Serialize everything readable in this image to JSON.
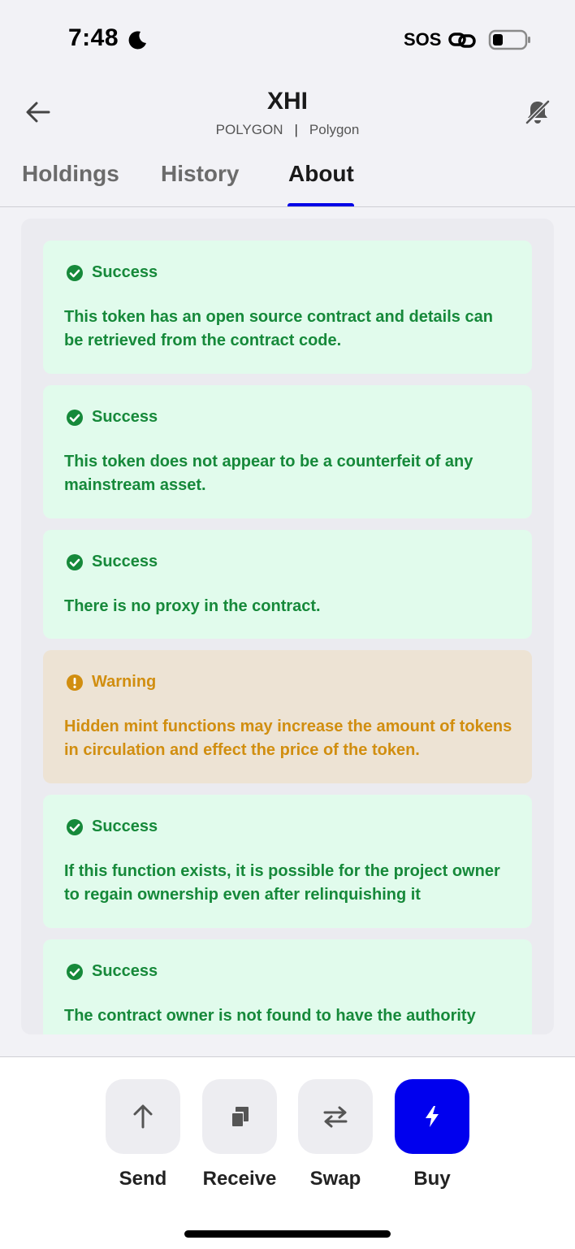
{
  "status_bar": {
    "time": "7:48",
    "sos": "SOS",
    "icons": [
      "moon-icon",
      "link-icon",
      "battery-icon"
    ]
  },
  "header": {
    "title": "XHI",
    "network_code": "POLYGON",
    "separator": "|",
    "network_name": "Polygon",
    "icons": [
      "back-arrow-icon",
      "bell-muted-icon"
    ]
  },
  "tabs": [
    {
      "label": "Holdings",
      "active": false
    },
    {
      "label": "History",
      "active": false
    },
    {
      "label": "About",
      "active": true
    }
  ],
  "checks": [
    {
      "status": "Success",
      "type": "success",
      "text": "This token has an open source contract and details can be retrieved from the contract code."
    },
    {
      "status": "Success",
      "type": "success",
      "text": "This token does not appear to be a counterfeit of any mainstream asset."
    },
    {
      "status": "Success",
      "type": "success",
      "text": "There is no proxy in the contract."
    },
    {
      "status": "Warning",
      "type": "warning",
      "text": "Hidden mint functions may increase the amount of tokens in circulation and effect the price of the token."
    },
    {
      "status": "Success",
      "type": "success",
      "text": "If this function exists, it is possible for the project owner to regain ownership even after relinquishing it"
    },
    {
      "status": "Success",
      "type": "success",
      "text": "The contract owner is not found to have the authority"
    }
  ],
  "actions": [
    {
      "label": "Send",
      "icon": "arrow-up-icon"
    },
    {
      "label": "Receive",
      "icon": "copy-icon"
    },
    {
      "label": "Swap",
      "icon": "swap-arrows-icon"
    },
    {
      "label": "Buy",
      "icon": "lightning-icon"
    }
  ],
  "colors": {
    "accent": "#0000ee",
    "success_bg": "#e1fbec",
    "success_text": "#16893a",
    "warning_bg": "#ede3d4",
    "warning_text": "#d18e10"
  }
}
